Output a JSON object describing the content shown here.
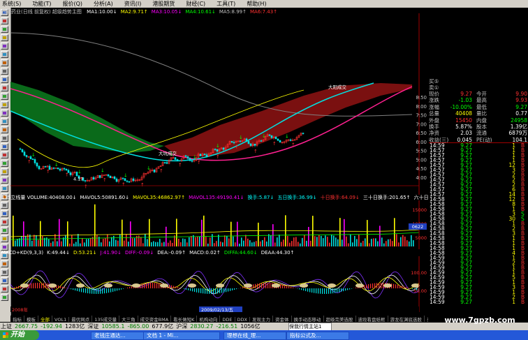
{
  "menu": [
    "系统(S)",
    "功能(T)",
    "报价(Q)",
    "分析(A)",
    "资讯(I)",
    "港股期货",
    "财经(C)",
    "工具(T)",
    "帮助(H)"
  ],
  "chart_title": "西藏药业(日线 前复权) 超级趋势主图",
  "ma_legend": [
    {
      "text": "MA1:10.00",
      "arrow": "↓",
      "color": "#ffffff"
    },
    {
      "text": "MA2:9.71",
      "arrow": "↑",
      "color": "#ffff00"
    },
    {
      "text": "MA3:10.05",
      "arrow": "↓",
      "color": "#ff00ff"
    },
    {
      "text": "MA4:10.61",
      "arrow": "↓",
      "color": "#00ff00"
    },
    {
      "text": "MA5:8.99",
      "arrow": "↑",
      "color": "#c0c0c0"
    },
    {
      "text": "MA6:7.43",
      "arrow": "↑",
      "color": "#ff3030"
    }
  ],
  "price_ticks": [
    "8.50",
    "8.00",
    "7.50",
    "7.00",
    "6.50",
    "6.00",
    "5.50",
    "5.00",
    "4.50",
    "4.00"
  ],
  "annotations": {
    "low": "4.17",
    "label1": "大阳成交",
    "label2": "大坑成交"
  },
  "volume_legend": [
    {
      "text": "135立线量 VOLUME:40408.00",
      "arrow": "↓",
      "color": "#ffffff"
    },
    {
      "text": "MAVOL5:50891.60",
      "arrow": "↓",
      "color": "#ffffff"
    },
    {
      "text": "MAVOL35:46862.97",
      "arrow": "↑",
      "color": "#ffff00"
    },
    {
      "text": "MAVOL135:49190.41",
      "arrow": "↓",
      "color": "#ff00ff"
    },
    {
      "text": "换手:5.87",
      "arrow": "↓",
      "color": "#00ffff"
    },
    {
      "text": "五日换手:36.99",
      "arrow": "↓",
      "color": "#00ffff"
    },
    {
      "text": "十日换手:64.09",
      "arrow": "↓",
      "color": "#ff3030"
    },
    {
      "text": "三十日换手:201.65",
      "arrow": "↑",
      "color": "#ffffff"
    },
    {
      "text": "六十日换手",
      "arrow": "",
      "color": "#ffffff"
    }
  ],
  "volume_ticks": [
    "15000",
    "10000",
    "5000"
  ],
  "volume_box": "0622",
  "macd_legend": [
    {
      "text": "MACD+KD(9,3,3)",
      "arrow": "",
      "color": "#ffffff"
    },
    {
      "text": "K:49.44",
      "arrow": "↓",
      "color": "#ffffff"
    },
    {
      "text": "D:53.21",
      "arrow": "↓",
      "color": "#ffff00"
    },
    {
      "text": "J:41.90",
      "arrow": "↓",
      "color": "#ff00ff"
    },
    {
      "text": "DIFF:-0.09",
      "arrow": "↓",
      "color": "#ff00ff"
    },
    {
      "text": "DEA:-0.09",
      "arrow": "↑",
      "color": "#ffffff"
    },
    {
      "text": "MACD:0.02",
      "arrow": "↑",
      "color": "#ffffff"
    },
    {
      "text": "DIFFA:44.60",
      "arrow": "↓",
      "color": "#00ff00"
    },
    {
      "text": "DEAA:44.30",
      "arrow": "↑",
      "color": "#ffffff"
    }
  ],
  "macd_ticks": [
    "100.00",
    "50.00"
  ],
  "date_axis": {
    "start": "2008年",
    "cursor": "2009/02/13/五"
  },
  "quote_header": [
    "买⑤",
    "卖①"
  ],
  "quote": [
    {
      "l": "现价",
      "v": "9.27",
      "l2": "今开",
      "v2": "9.90",
      "c": "#ff3030",
      "c2": "#ff3030"
    },
    {
      "l": "涨跌",
      "v": "-1.03",
      "l2": "最高",
      "v2": "9.93",
      "c": "#00ff00",
      "c2": "#ff3030"
    },
    {
      "l": "涨幅",
      "v": "-10.00%",
      "l2": "最低",
      "v2": "9.27",
      "c": "#00ff00",
      "c2": "#00ff00"
    },
    {
      "l": "总量",
      "v": "40408",
      "l2": "量比",
      "v2": "0.77",
      "c": "#ffff00",
      "c2": "#ffffff"
    },
    {
      "l": "外盘",
      "v": "15450",
      "l2": "内盘",
      "v2": "24958",
      "c": "#ff3030",
      "c2": "#00ff00"
    },
    {
      "l": "换手",
      "v": "5.87%",
      "l2": "股本",
      "v2": "1.39亿",
      "c": "#ffffff",
      "c2": "#ffffff"
    },
    {
      "l": "净资",
      "v": "2.03",
      "l2": "流通",
      "v2": "6879万",
      "c": "#ffffff",
      "c2": "#ffffff"
    },
    {
      "l": "收益(三)",
      "v": "0.045",
      "l2": "PE(动)",
      "v2": "104.1",
      "c": "#ffffff",
      "c2": "#ffffff"
    }
  ],
  "ticks": [
    [
      "14:59",
      "9.27",
      "1",
      "B"
    ],
    [
      "14:57",
      "9.27",
      "1",
      "B"
    ],
    [
      "14:57",
      "9.27",
      "1",
      "B"
    ],
    [
      "14:57",
      "9.27",
      "1",
      "B"
    ],
    [
      "14:57",
      "9.27",
      "12",
      "B"
    ],
    [
      "14:57",
      "9.27",
      "3",
      "B"
    ],
    [
      "14:57",
      "9.27",
      "2",
      "B"
    ],
    [
      "14:57",
      "9.27",
      "2",
      "B"
    ],
    [
      "14:57",
      "9.27",
      "2",
      "B"
    ],
    [
      "14:57",
      "9.27",
      "6",
      "B"
    ],
    [
      "14:57",
      "9.27",
      "14",
      "B"
    ],
    [
      "14:58",
      "9.27",
      "12",
      "B"
    ],
    [
      "14:58",
      "9.27",
      "8",
      "B"
    ],
    [
      "14:58",
      "9.27",
      "1",
      "B"
    ],
    [
      "14:58",
      "9.27",
      "3",
      "S"
    ],
    [
      "14:58",
      "9.27",
      "30",
      "S"
    ],
    [
      "14:58",
      "9.27",
      "1",
      "B"
    ],
    [
      "14:58",
      "9.27",
      "2",
      "B"
    ],
    [
      "14:58",
      "9.27",
      "3",
      "B"
    ],
    [
      "14:58",
      "9.27",
      "1",
      "B"
    ],
    [
      "14:58",
      "9.27",
      "1",
      "B"
    ],
    [
      "14:58",
      "9.27",
      "1",
      "B"
    ],
    [
      "14:58",
      "9.27",
      "4",
      "B"
    ],
    [
      "14:59",
      "9.27",
      "1",
      "B"
    ],
    [
      "14:59",
      "9.27",
      "2",
      "B"
    ],
    [
      "14:59",
      "9.27",
      "1",
      "B"
    ],
    [
      "14:59",
      "9.27",
      "1",
      "B"
    ],
    [
      "14:59",
      "9.27",
      "5",
      "B"
    ],
    [
      "14:59",
      "9.27",
      "1",
      "B"
    ],
    [
      "14:59",
      "9.27",
      "3",
      "B"
    ],
    [
      "14:59",
      "9.27",
      "1",
      "B"
    ],
    [
      "14:59",
      "9.27",
      "2",
      "B"
    ],
    [
      "14:59",
      "9.27",
      "1",
      "B"
    ],
    [
      "14:59",
      "9.27",
      "1",
      "B"
    ]
  ],
  "tabs": [
    "指标",
    "模板",
    "全部",
    "VOL1",
    "最优网点",
    "135成交量",
    "大三角",
    "成交资金BMA",
    "看长做短K",
    "机构动向",
    "DDE",
    "DDX",
    "发现主力",
    "资金体",
    "换手动态移动",
    "超级完美选股",
    "波段看盘纸框",
    "游龙在渊底选股",
    "买卖趋势选股",
    "绝对底"
  ],
  "index_bar": [
    {
      "t": "上证",
      "c": "#000000"
    },
    {
      "t": "2667.75",
      "c": "#008000"
    },
    {
      "t": "-192.94",
      "c": "#008000"
    },
    {
      "t": "1283亿",
      "c": "#000000"
    },
    {
      "t": "深证",
      "c": "#000000"
    },
    {
      "t": "10585.1",
      "c": "#008000"
    },
    {
      "t": "-865.00",
      "c": "#008000"
    },
    {
      "t": "677.9亿",
      "c": "#000000"
    },
    {
      "t": "沪深",
      "c": "#000000"
    },
    {
      "t": "2830.27",
      "c": "#008000"
    },
    {
      "t": "-216.51",
      "c": "#008000"
    },
    {
      "t": "1056亿",
      "c": "#000000"
    }
  ],
  "stock_button": "保我行情主站1",
  "start_label": "开始",
  "tasks": [
    "老钱庄通达...",
    "文档 1 - Mi...",
    "理想在线_理...",
    "指标公式及..."
  ],
  "watermark": "www.7gpzb.com"
}
